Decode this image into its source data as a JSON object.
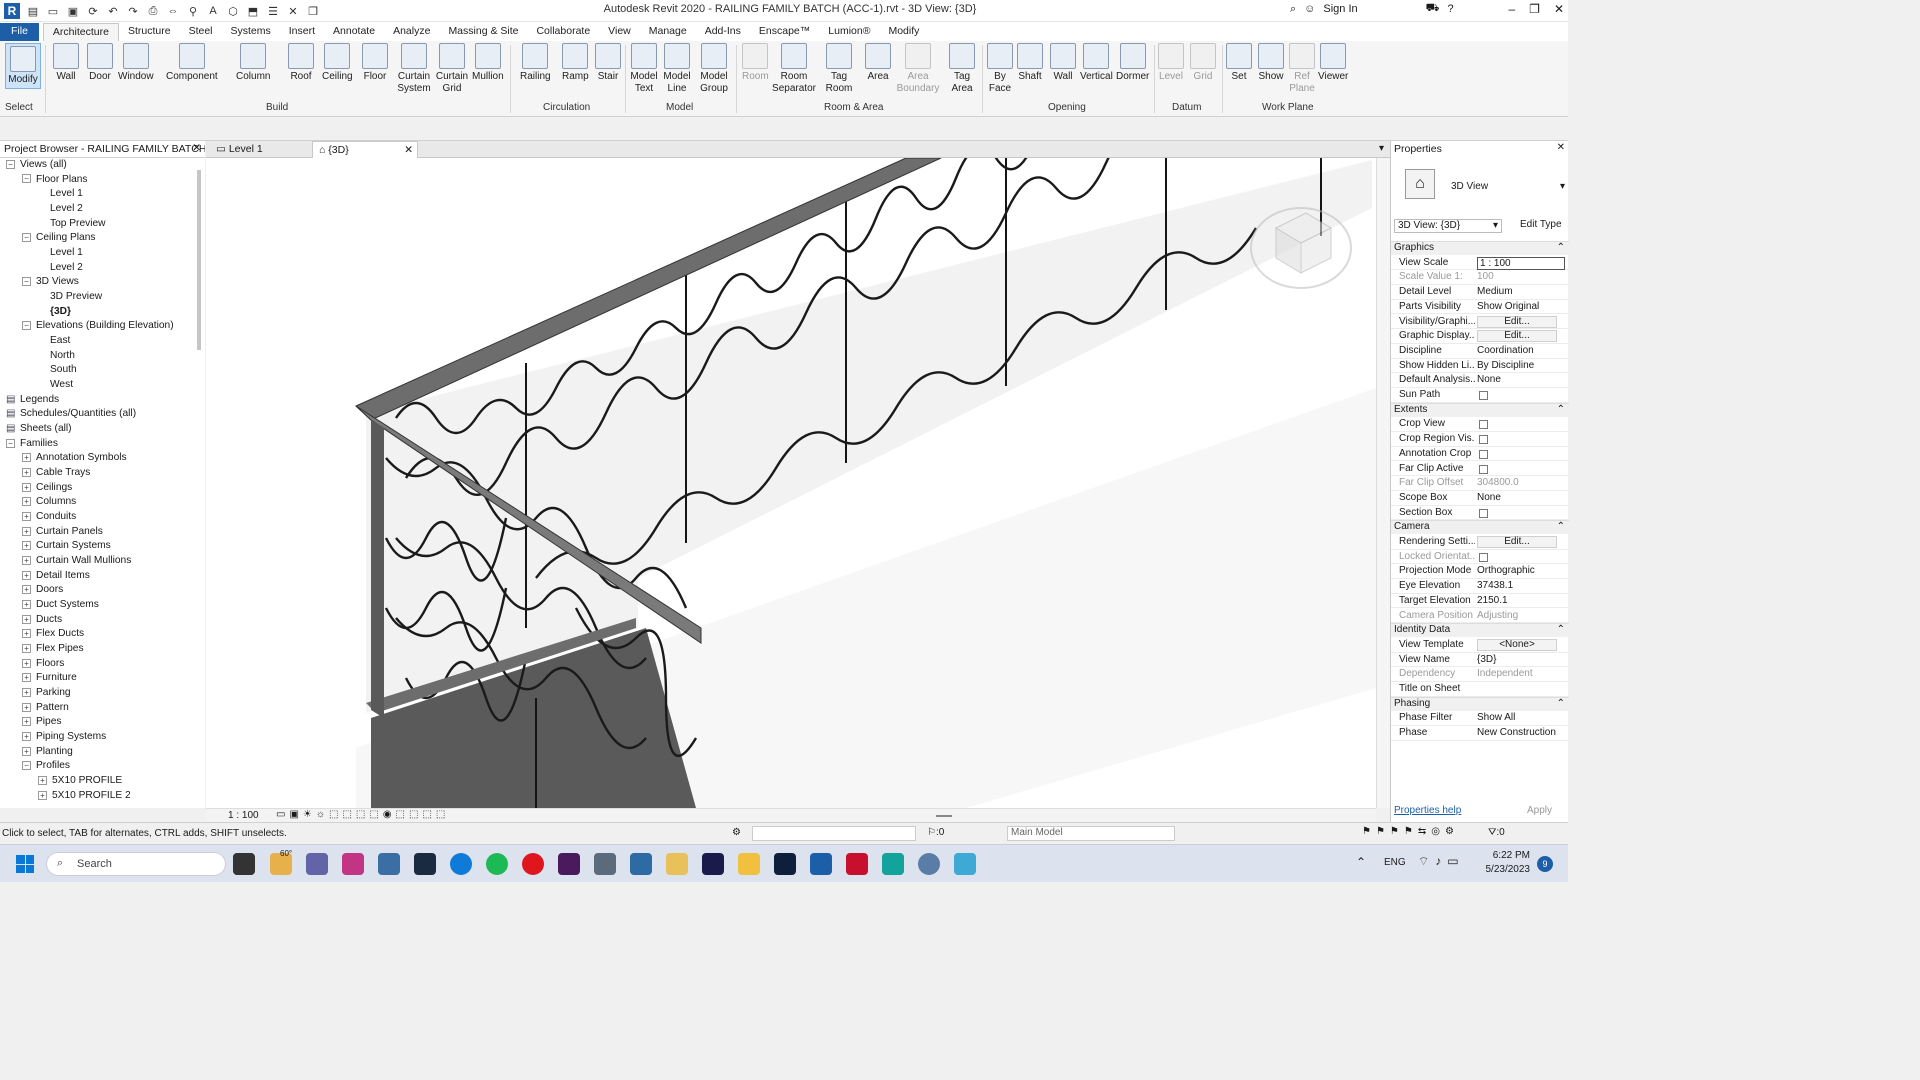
{
  "window": {
    "title": "Autodesk Revit 2020 - RAILING FAMILY BATCH (ACC-1).rvt - 3D View: {3D}",
    "sign_in": "Sign In"
  },
  "ribbon_tabs": [
    "File",
    "Architecture",
    "Structure",
    "Steel",
    "Systems",
    "Insert",
    "Annotate",
    "Analyze",
    "Massing & Site",
    "Collaborate",
    "View",
    "Manage",
    "Add-Ins",
    "Enscape™",
    "Lumion®",
    "Modify"
  ],
  "ribbon": {
    "modify": "Modify",
    "select": "Select",
    "build": {
      "label": "Build",
      "buttons": [
        "Wall",
        "Door",
        "Window",
        "Component",
        "Column",
        "Roof",
        "Ceiling",
        "Floor",
        "Curtain System",
        "Curtain Grid",
        "Mullion"
      ]
    },
    "circulation": {
      "label": "Circulation",
      "buttons": [
        "Railing",
        "Ramp",
        "Stair"
      ]
    },
    "model": {
      "label": "Model",
      "buttons": [
        "Model Text",
        "Model Line",
        "Model Group"
      ]
    },
    "room_area": {
      "label": "Room & Area",
      "buttons": [
        "Room",
        "Room Separator",
        "Tag Room",
        "Area",
        "Area Boundary",
        "Tag Area"
      ]
    },
    "opening": {
      "label": "Opening",
      "buttons": [
        "By Face",
        "Shaft",
        "Wall",
        "Vertical",
        "Dormer"
      ]
    },
    "datum": {
      "label": "Datum",
      "buttons": [
        "Level",
        "Grid"
      ]
    },
    "work_plane": {
      "label": "Work Plane",
      "buttons": [
        "Set",
        "Show",
        "Ref Plane",
        "Viewer"
      ]
    }
  },
  "project_browser": {
    "title": "Project Browser - RAILING FAMILY BATCH...",
    "items": [
      {
        "label": "Views (all)",
        "level": 0,
        "exp": "-"
      },
      {
        "label": "Floor Plans",
        "level": 1,
        "exp": "-"
      },
      {
        "label": "Level 1",
        "level": 2,
        "exp": ""
      },
      {
        "label": "Level 2",
        "level": 2,
        "exp": ""
      },
      {
        "label": "Top Preview",
        "level": 2,
        "exp": ""
      },
      {
        "label": "Ceiling Plans",
        "level": 1,
        "exp": "-"
      },
      {
        "label": "Level 1",
        "level": 2,
        "exp": ""
      },
      {
        "label": "Level 2",
        "level": 2,
        "exp": ""
      },
      {
        "label": "3D Views",
        "level": 1,
        "exp": "-"
      },
      {
        "label": "3D Preview",
        "level": 2,
        "exp": ""
      },
      {
        "label": "{3D}",
        "level": 2,
        "exp": "",
        "bold": true
      },
      {
        "label": "Elevations (Building Elevation)",
        "level": 1,
        "exp": "-"
      },
      {
        "label": "East",
        "level": 2,
        "exp": ""
      },
      {
        "label": "North",
        "level": 2,
        "exp": ""
      },
      {
        "label": "South",
        "level": 2,
        "exp": ""
      },
      {
        "label": "West",
        "level": 2,
        "exp": ""
      },
      {
        "label": "Legends",
        "level": 0,
        "exp": ""
      },
      {
        "label": "Schedules/Quantities (all)",
        "level": 0,
        "exp": ""
      },
      {
        "label": "Sheets (all)",
        "level": 0,
        "exp": ""
      },
      {
        "label": "Families",
        "level": 0,
        "exp": "-"
      },
      {
        "label": "Annotation Symbols",
        "level": 1,
        "exp": "+"
      },
      {
        "label": "Cable Trays",
        "level": 1,
        "exp": "+"
      },
      {
        "label": "Ceilings",
        "level": 1,
        "exp": "+"
      },
      {
        "label": "Columns",
        "level": 1,
        "exp": "+"
      },
      {
        "label": "Conduits",
        "level": 1,
        "exp": "+"
      },
      {
        "label": "Curtain Panels",
        "level": 1,
        "exp": "+"
      },
      {
        "label": "Curtain Systems",
        "level": 1,
        "exp": "+"
      },
      {
        "label": "Curtain Wall Mullions",
        "level": 1,
        "exp": "+"
      },
      {
        "label": "Detail Items",
        "level": 1,
        "exp": "+"
      },
      {
        "label": "Doors",
        "level": 1,
        "exp": "+"
      },
      {
        "label": "Duct Systems",
        "level": 1,
        "exp": "+"
      },
      {
        "label": "Ducts",
        "level": 1,
        "exp": "+"
      },
      {
        "label": "Flex Ducts",
        "level": 1,
        "exp": "+"
      },
      {
        "label": "Flex Pipes",
        "level": 1,
        "exp": "+"
      },
      {
        "label": "Floors",
        "level": 1,
        "exp": "+"
      },
      {
        "label": "Furniture",
        "level": 1,
        "exp": "+"
      },
      {
        "label": "Parking",
        "level": 1,
        "exp": "+"
      },
      {
        "label": "Pattern",
        "level": 1,
        "exp": "+"
      },
      {
        "label": "Pipes",
        "level": 1,
        "exp": "+"
      },
      {
        "label": "Piping Systems",
        "level": 1,
        "exp": "+"
      },
      {
        "label": "Planting",
        "level": 1,
        "exp": "+"
      },
      {
        "label": "Profiles",
        "level": 1,
        "exp": "-"
      },
      {
        "label": "5X10 PROFILE",
        "level": 2,
        "exp": "+"
      },
      {
        "label": "5X10 PROFILE 2",
        "level": 2,
        "exp": "+"
      }
    ]
  },
  "view_tabs": [
    "Level 1",
    "{3D}"
  ],
  "view_bar": {
    "scale": "1 : 100"
  },
  "properties": {
    "title": "Properties",
    "type_name": "3D View",
    "selector": "3D View: {3D}",
    "edit_type": "Edit Type",
    "sections": [
      {
        "name": "Graphics",
        "rows": [
          {
            "k": "View Scale",
            "v": "1 : 100"
          },
          {
            "k": "Scale Value   1:",
            "v": "100",
            "dim": true
          },
          {
            "k": "Detail Level",
            "v": "Medium"
          },
          {
            "k": "Parts Visibility",
            "v": "Show Original"
          },
          {
            "k": "Visibility/Graphi...",
            "v": "Edit...",
            "btn": true
          },
          {
            "k": "Graphic Display...",
            "v": "Edit...",
            "btn": true
          },
          {
            "k": "Discipline",
            "v": "Coordination"
          },
          {
            "k": "Show Hidden Li...",
            "v": "By Discipline"
          },
          {
            "k": "Default Analysis...",
            "v": "None"
          },
          {
            "k": "Sun Path",
            "v": "",
            "cb": true
          }
        ]
      },
      {
        "name": "Extents",
        "rows": [
          {
            "k": "Crop View",
            "v": "",
            "cb": true
          },
          {
            "k": "Crop Region Vis...",
            "v": "",
            "cb": true
          },
          {
            "k": "Annotation Crop",
            "v": "",
            "cb": true
          },
          {
            "k": "Far Clip Active",
            "v": "",
            "cb": true
          },
          {
            "k": "Far Clip Offset",
            "v": "304800.0",
            "dim": true
          },
          {
            "k": "Scope Box",
            "v": "None"
          },
          {
            "k": "Section Box",
            "v": "",
            "cb": true
          }
        ]
      },
      {
        "name": "Camera",
        "rows": [
          {
            "k": "Rendering Setti...",
            "v": "Edit...",
            "btn": true
          },
          {
            "k": "Locked Orientat...",
            "v": "",
            "cb": true,
            "dim": true
          },
          {
            "k": "Projection Mode",
            "v": "Orthographic"
          },
          {
            "k": "Eye Elevation",
            "v": "37438.1"
          },
          {
            "k": "Target Elevation",
            "v": "2150.1"
          },
          {
            "k": "Camera Position",
            "v": "Adjusting",
            "dim": true
          }
        ]
      },
      {
        "name": "Identity Data",
        "rows": [
          {
            "k": "View Template",
            "v": "<None>",
            "btn": true
          },
          {
            "k": "View Name",
            "v": "{3D}"
          },
          {
            "k": "Dependency",
            "v": "Independent",
            "dim": true
          },
          {
            "k": "Title on Sheet",
            "v": ""
          }
        ]
      },
      {
        "name": "Phasing",
        "rows": [
          {
            "k": "Phase Filter",
            "v": "Show All"
          },
          {
            "k": "Phase",
            "v": "New Construction"
          }
        ]
      }
    ],
    "help": "Properties help",
    "apply": "Apply"
  },
  "status": {
    "hint": "Click to select, TAB for alternates, CTRL adds, SHIFT unselects.",
    "count": ":0",
    "model": "Main Model",
    "filter": ":0"
  },
  "taskbar": {
    "search": "Search",
    "weather": "60°",
    "lang": "ENG",
    "time": "6:22 PM",
    "date": "5/23/2023",
    "badge": "9"
  }
}
